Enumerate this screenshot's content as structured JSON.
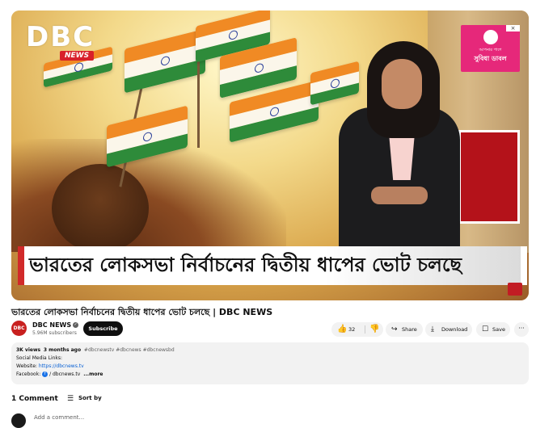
{
  "video": {
    "logo_text": "DBC",
    "logo_tag": "NEWS",
    "lower_third": "ভারতের লোকসভা নির্বাচনের দ্বিতীয় ধাপের ভোট চলছে",
    "ad_line1": "আপনার পাশে",
    "ad_line2": "সুবিধা ডাবল",
    "ad_close": "×"
  },
  "title": "ভারতের লোকসভা নির্বাচনের দ্বিতীয় ধাপের ভোট চলছে | DBC NEWS",
  "channel": {
    "avatar_text": "DBC",
    "name": "DBC NEWS",
    "subscribers": "5.96M subscribers",
    "subscribe_label": "Subscribe"
  },
  "actions": {
    "like_count": "32",
    "share_label": "Share",
    "download_label": "Download",
    "save_label": "Save",
    "more_label": "···"
  },
  "description": {
    "views": "3K views",
    "age": "3 months ago",
    "tags": "#dbcnewstv #dbcnews #dbcnewsbd",
    "line2": "Social Media Links:",
    "website_label": "Website:",
    "website_url": "https://dbcnews.tv",
    "facebook_label": "Facebook:",
    "facebook_url": "/ dbcnews.tv",
    "more": "...more"
  },
  "comments": {
    "count_label": "1 Comment",
    "sort_label": "Sort by",
    "add_placeholder": "Add a comment..."
  },
  "colors": {
    "brand_red": "#d12a2a",
    "subscribe_bg": "#0f0f0f",
    "link": "#065fd4",
    "ad_pink": "#e6287a"
  },
  "icons": [
    "like-icon",
    "dislike-icon",
    "share-icon",
    "download-icon",
    "save-icon",
    "more-icon",
    "sort-icon",
    "verified-icon",
    "facebook-icon"
  ]
}
